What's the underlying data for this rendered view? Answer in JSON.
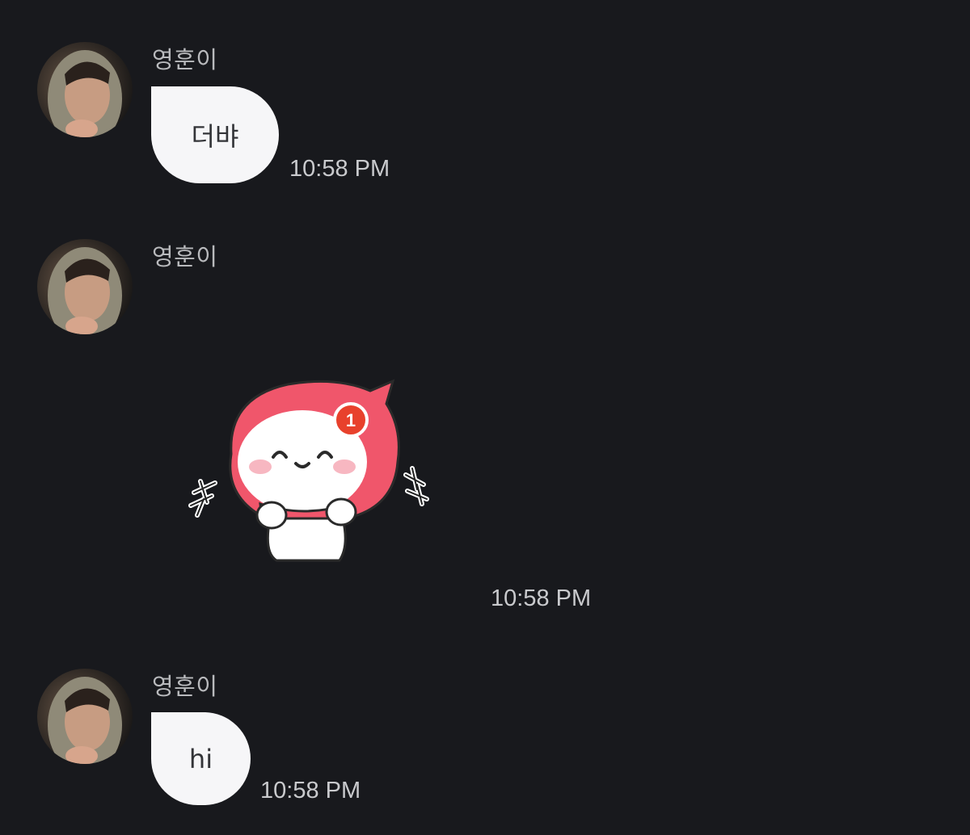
{
  "messages": [
    {
      "sender": "영훈이",
      "type": "text",
      "text": "더뱌",
      "time": "10:58 PM"
    },
    {
      "sender": "영훈이",
      "type": "sticker",
      "sticker_icon": "smiling-red-hood-character-sticker",
      "badge_text": "1",
      "time": "10:58 PM"
    },
    {
      "sender": "영훈이",
      "type": "text",
      "text": "hi",
      "time": "10:58 PM"
    }
  ],
  "colors": {
    "background": "#18191d",
    "bubble": "#f6f6f8",
    "sticker_hood": "#f0566b",
    "badge": "#e8412c"
  }
}
